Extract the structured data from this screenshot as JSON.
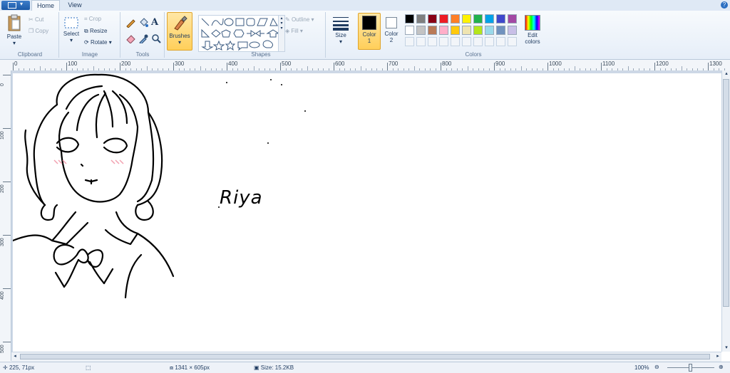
{
  "tabs": {
    "home": "Home",
    "view": "View"
  },
  "clipboard": {
    "paste": "Paste",
    "cut": "Cut",
    "copy": "Copy",
    "group": "Clipboard"
  },
  "image": {
    "select": "Select",
    "crop": "Crop",
    "resize": "Resize",
    "rotate": "Rotate",
    "group": "Image"
  },
  "tools": {
    "group": "Tools",
    "text_glyph": "A"
  },
  "brushes": {
    "label": "Brushes"
  },
  "shapes": {
    "outline": "Outline",
    "fill": "Fill",
    "group": "Shapes"
  },
  "size": {
    "label": "Size"
  },
  "color1": {
    "label": "Color",
    "num": "1",
    "value": "#000000"
  },
  "color2": {
    "label": "Color",
    "num": "2",
    "value": "#ffffff"
  },
  "colors": {
    "group": "Colors",
    "edit_label": "Edit",
    "edit_label2": "colors",
    "palette": [
      "#000000",
      "#7f7f7f",
      "#880015",
      "#ed1c24",
      "#ff7f27",
      "#fff200",
      "#22b14c",
      "#00a2e8",
      "#3f48cc",
      "#a349a4",
      "#ffffff",
      "#c3c3c3",
      "#b97a57",
      "#ffaec9",
      "#ffc90e",
      "#efe4b0",
      "#b5e61d",
      "#99d9ea",
      "#7092be",
      "#c8bfe7"
    ]
  },
  "ruler": {
    "h_ticks": [
      "0",
      "100",
      "200",
      "300",
      "400",
      "500",
      "600",
      "700",
      "800",
      "900",
      "1000",
      "1100",
      "1200",
      "1300"
    ],
    "v_ticks": [
      "0",
      "100",
      "200",
      "300",
      "400",
      "500"
    ]
  },
  "drawing": {
    "text": "Riya"
  },
  "status": {
    "position": "225, 71px",
    "dimensions": "1341 × 605px",
    "size": "Size: 15.2KB",
    "zoom": "100%"
  }
}
